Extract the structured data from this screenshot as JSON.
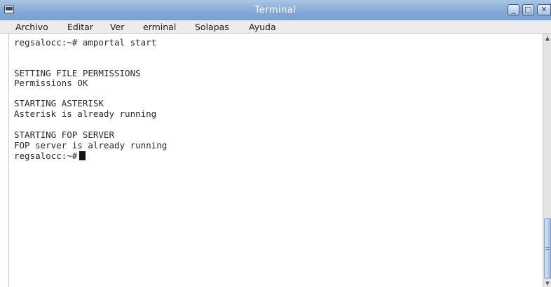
{
  "window": {
    "title": "Terminal"
  },
  "controls": {
    "minimize": "_",
    "maximize": "□",
    "close": "✕"
  },
  "menu": [
    "Archivo",
    "Editar",
    "Ver",
    "erminal",
    "Solapas",
    "Ayuda"
  ],
  "terminal": {
    "lines": [
      "regsalocc:~# amportal start",
      "",
      "",
      "SETTING FILE PERMISSIONS",
      "Permissions OK",
      "",
      "STARTING ASTERISK",
      "Asterisk is already running",
      "",
      "STARTING FOP SERVER",
      "FOP server is already running"
    ],
    "prompt": "regsalocc:~#"
  },
  "scrollbar": {
    "up_arrow": "▲",
    "down_arrow": "▼"
  },
  "icons": {
    "window_icon": "terminal-window-icon",
    "close": "close-icon",
    "maximize": "maximize-icon",
    "minimize": "minimize-icon"
  },
  "colors": {
    "titlebar": "#86a9d6",
    "menubar": "#ececec",
    "text": "#2a2a2a",
    "cursor": "#111111"
  }
}
